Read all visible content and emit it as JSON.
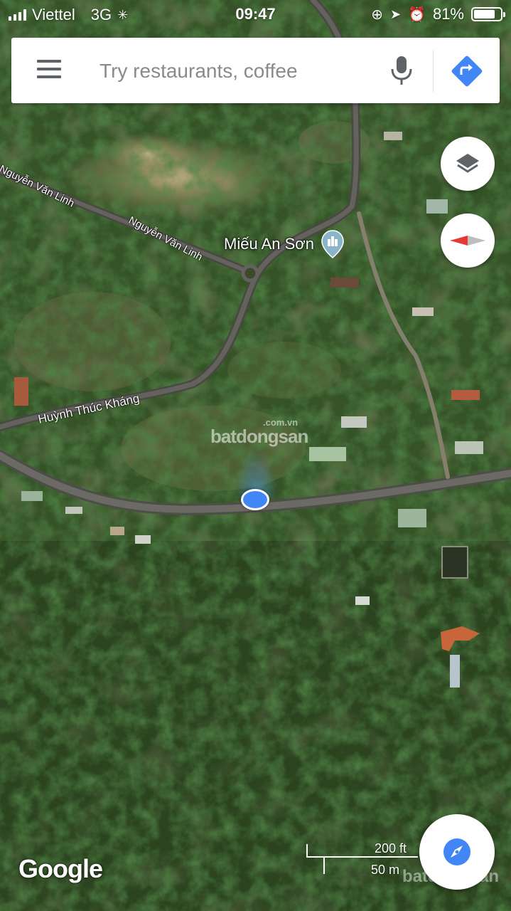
{
  "status_bar": {
    "carrier": "Viettel",
    "network": "3G",
    "time": "09:47",
    "battery_percent": "81%",
    "battery_level": 0.81
  },
  "search": {
    "placeholder": "Try restaurants, coffee"
  },
  "map": {
    "poi_label": "Miếu An Sơn",
    "roads": [
      "Nguyễn Văn Linh",
      "Nguyễn Văn Linh",
      "Huỳnh Thúc Kháng"
    ],
    "watermark_domain": ".com.vn",
    "watermark_brand": "batdongsan"
  },
  "footer": {
    "google_logo": "Google",
    "scale_ft": "200 ft",
    "scale_m": "50 m"
  },
  "colors": {
    "accent": "#4285f4",
    "compass_red": "#e53935",
    "poi_pin": "#8ab4c8"
  },
  "icons": [
    "menu-icon",
    "microphone-icon",
    "directions-icon",
    "layers-icon",
    "compass-icon",
    "my-location-icon"
  ]
}
